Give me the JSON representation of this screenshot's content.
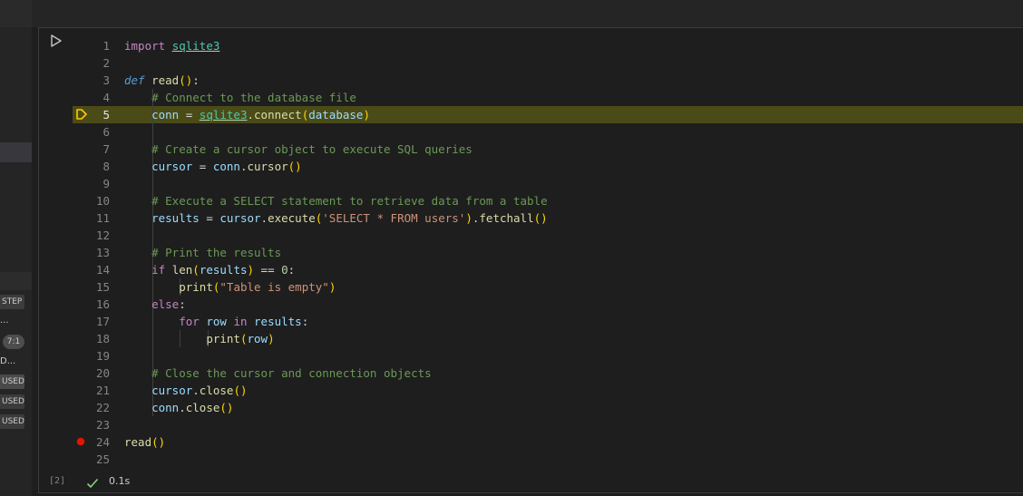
{
  "sidebar": {
    "badges": [
      "STEP",
      "USED",
      "USED",
      "USED"
    ],
    "ellipsis_1": "...",
    "ellipsis_2": "D...",
    "position_pill": "7:1"
  },
  "cell": {
    "execution_count": "[2]",
    "exec_time": "0.1s",
    "current_line": 5,
    "breakpoint_line": 24
  },
  "code_lines": [
    {
      "n": "1",
      "tokens": [
        [
          "kw-import",
          "import"
        ],
        [
          "op",
          " "
        ],
        [
          "mod",
          "sqlite3"
        ]
      ]
    },
    {
      "n": "2",
      "tokens": []
    },
    {
      "n": "3",
      "tokens": [
        [
          "kw-def",
          "def"
        ],
        [
          "op",
          " "
        ],
        [
          "fn",
          "read"
        ],
        [
          "br1",
          "()"
        ],
        [
          "op",
          ":"
        ]
      ]
    },
    {
      "n": "4",
      "tokens": [
        [
          "op",
          "    "
        ],
        [
          "cmt",
          "# Connect to the database file"
        ]
      ]
    },
    {
      "n": "5",
      "tokens": [
        [
          "op",
          "    "
        ],
        [
          "var",
          "conn"
        ],
        [
          "op",
          " = "
        ],
        [
          "mod",
          "sqlite3"
        ],
        [
          "op",
          "."
        ],
        [
          "fn",
          "connect"
        ],
        [
          "br1",
          "("
        ],
        [
          "var",
          "database"
        ],
        [
          "br1",
          ")"
        ]
      ]
    },
    {
      "n": "6",
      "tokens": []
    },
    {
      "n": "7",
      "tokens": [
        [
          "op",
          "    "
        ],
        [
          "cmt",
          "# Create a cursor object to execute SQL queries"
        ]
      ]
    },
    {
      "n": "8",
      "tokens": [
        [
          "op",
          "    "
        ],
        [
          "var",
          "cursor"
        ],
        [
          "op",
          " = "
        ],
        [
          "var",
          "conn"
        ],
        [
          "op",
          "."
        ],
        [
          "fn",
          "cursor"
        ],
        [
          "br1",
          "()"
        ]
      ]
    },
    {
      "n": "9",
      "tokens": []
    },
    {
      "n": "10",
      "tokens": [
        [
          "op",
          "    "
        ],
        [
          "cmt",
          "# Execute a SELECT statement to retrieve data from a table"
        ]
      ]
    },
    {
      "n": "11",
      "tokens": [
        [
          "op",
          "    "
        ],
        [
          "var",
          "results"
        ],
        [
          "op",
          " = "
        ],
        [
          "var",
          "cursor"
        ],
        [
          "op",
          "."
        ],
        [
          "fn",
          "execute"
        ],
        [
          "br1",
          "("
        ],
        [
          "str",
          "'SELECT * FROM users'"
        ],
        [
          "br1",
          ")"
        ],
        [
          "op",
          "."
        ],
        [
          "fn",
          "fetchall"
        ],
        [
          "br1",
          "()"
        ]
      ]
    },
    {
      "n": "12",
      "tokens": []
    },
    {
      "n": "13",
      "tokens": [
        [
          "op",
          "    "
        ],
        [
          "cmt",
          "# Print the results"
        ]
      ]
    },
    {
      "n": "14",
      "tokens": [
        [
          "op",
          "    "
        ],
        [
          "kw-ctrl",
          "if"
        ],
        [
          "op",
          " "
        ],
        [
          "fn",
          "len"
        ],
        [
          "br1",
          "("
        ],
        [
          "var",
          "results"
        ],
        [
          "br1",
          ")"
        ],
        [
          "op",
          " == "
        ],
        [
          "num",
          "0"
        ],
        [
          "op",
          ":"
        ]
      ]
    },
    {
      "n": "15",
      "tokens": [
        [
          "op",
          "        "
        ],
        [
          "fn",
          "print"
        ],
        [
          "br1",
          "("
        ],
        [
          "str",
          "\"Table is empty\""
        ],
        [
          "br1",
          ")"
        ]
      ]
    },
    {
      "n": "16",
      "tokens": [
        [
          "op",
          "    "
        ],
        [
          "kw-ctrl",
          "else"
        ],
        [
          "op",
          ":"
        ]
      ]
    },
    {
      "n": "17",
      "tokens": [
        [
          "op",
          "        "
        ],
        [
          "kw-ctrl",
          "for"
        ],
        [
          "op",
          " "
        ],
        [
          "var",
          "row"
        ],
        [
          "op",
          " "
        ],
        [
          "kw-ctrl",
          "in"
        ],
        [
          "op",
          " "
        ],
        [
          "var",
          "results"
        ],
        [
          "op",
          ":"
        ]
      ]
    },
    {
      "n": "18",
      "tokens": [
        [
          "op",
          "            "
        ],
        [
          "fn",
          "print"
        ],
        [
          "br1",
          "("
        ],
        [
          "var",
          "row"
        ],
        [
          "br1",
          ")"
        ]
      ]
    },
    {
      "n": "19",
      "tokens": []
    },
    {
      "n": "20",
      "tokens": [
        [
          "op",
          "    "
        ],
        [
          "cmt",
          "# Close the cursor and connection objects"
        ]
      ]
    },
    {
      "n": "21",
      "tokens": [
        [
          "op",
          "    "
        ],
        [
          "var",
          "cursor"
        ],
        [
          "op",
          "."
        ],
        [
          "fn",
          "close"
        ],
        [
          "br1",
          "()"
        ]
      ]
    },
    {
      "n": "22",
      "tokens": [
        [
          "op",
          "    "
        ],
        [
          "var",
          "conn"
        ],
        [
          "op",
          "."
        ],
        [
          "fn",
          "close"
        ],
        [
          "br1",
          "()"
        ]
      ]
    },
    {
      "n": "23",
      "tokens": []
    },
    {
      "n": "24",
      "tokens": [
        [
          "fn",
          "read"
        ],
        [
          "br1",
          "()"
        ]
      ]
    },
    {
      "n": "25",
      "tokens": []
    }
  ],
  "colors": {
    "current_line_bg": "#4b4b18",
    "breakpoint": "#e51400",
    "debug_arrow": "#ffcc00",
    "success_check": "#89d185"
  }
}
